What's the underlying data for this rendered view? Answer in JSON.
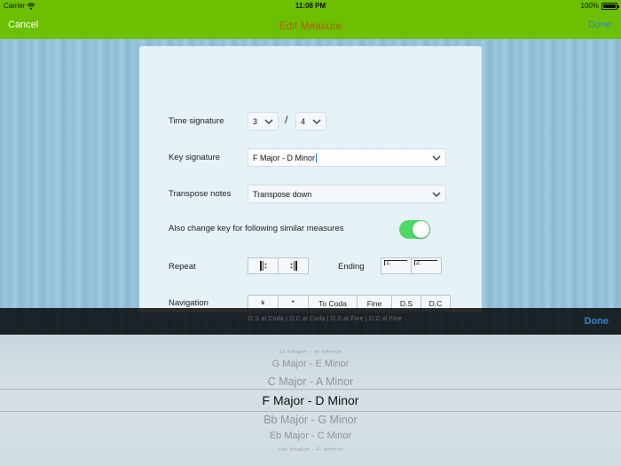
{
  "status_bar": {
    "carrier": "Carrier",
    "time": "11:08 PM",
    "battery": "100%"
  },
  "nav": {
    "cancel": "Cancel",
    "title": "Edit Measure",
    "done": "Done"
  },
  "form": {
    "time_signature": {
      "label": "Time signature",
      "numerator": "3",
      "separator": "/",
      "denominator": "4"
    },
    "key_signature": {
      "label": "Key signature",
      "value": "F Major - D Minor"
    },
    "transpose": {
      "label": "Transpose notes",
      "value": "Transpose down"
    },
    "also_change": {
      "label": "Also change key for following similar measures",
      "on": true
    },
    "repeat": {
      "label": "Repeat"
    },
    "ending": {
      "label": "Ending",
      "first": "1.",
      "second": "2."
    },
    "navigation": {
      "label": "Navigation",
      "buttons": [
        "𝄋",
        "𝄌",
        "To Coda",
        "Fine",
        "D.S",
        "D.C"
      ],
      "next_row": "D.S al Coda | D.C al Coda | D.S al Fine | D.C al Fine"
    }
  },
  "picker": {
    "done": "Done",
    "options": [
      "D Major - B Minor",
      "G Major - E Minor",
      "C Major - A Minor",
      "F Major - D Minor",
      "Bb Major - G Minor",
      "Eb Major - C Minor",
      "Ab Major - F Minor"
    ],
    "selected": "F Major - D Minor"
  },
  "colors": {
    "accent_green": "#6cc000",
    "title": "#b45a18",
    "link": "#2f86c8",
    "toggle_on": "#4cd964"
  },
  "icons": [
    "wifi-icon",
    "battery-icon",
    "chevron-down-icon",
    "repeat-start-icon",
    "repeat-end-icon",
    "segno-icon",
    "coda-icon"
  ]
}
